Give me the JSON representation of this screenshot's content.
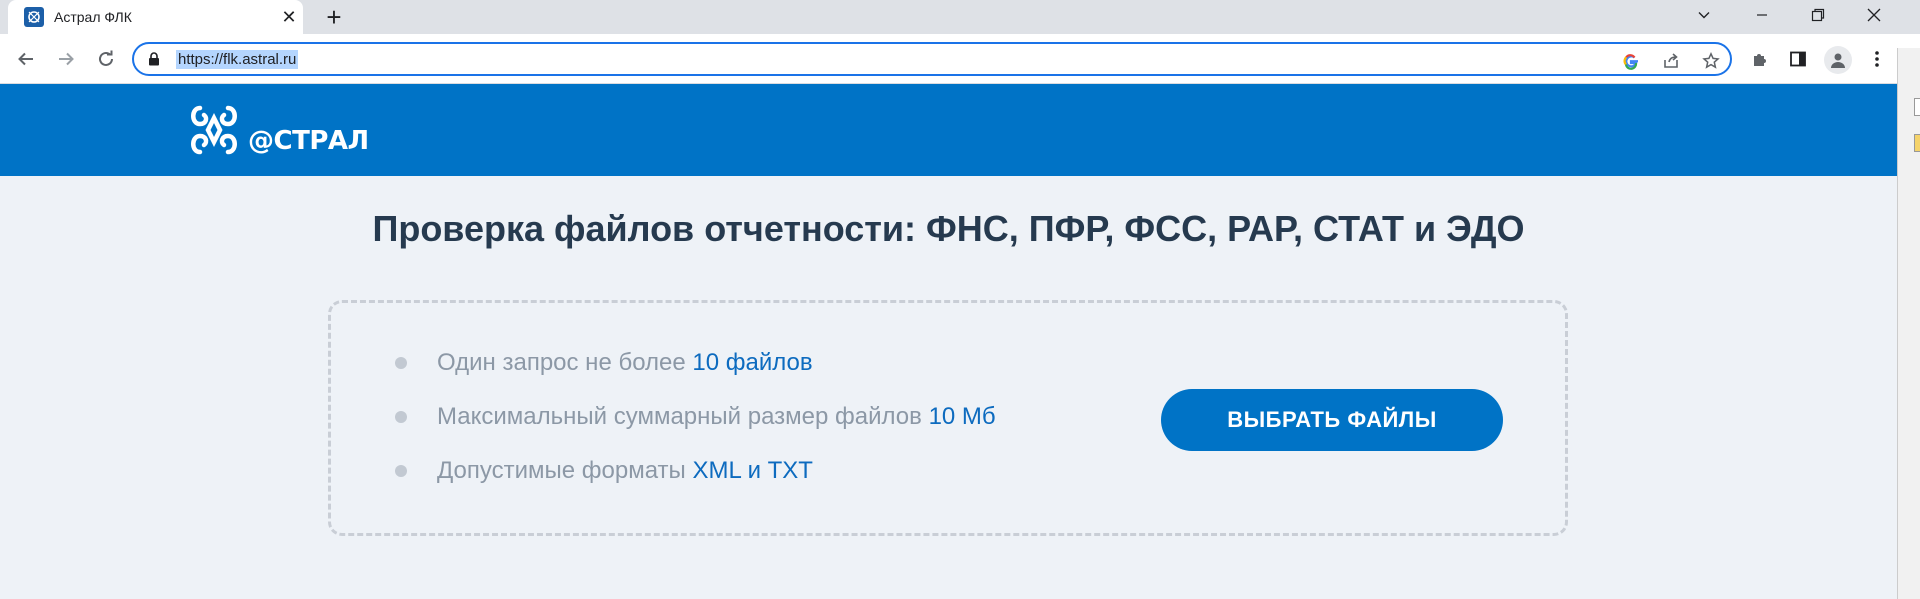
{
  "browser": {
    "tab_title": "Астрал ФЛК",
    "url": "https://flk.astral.ru",
    "new_tab_glyph": "+",
    "close_glyph": "✕"
  },
  "header": {
    "logo_text": "@СТРАЛ",
    "background": "#0073c6"
  },
  "main": {
    "title": "Проверка файлов отчетности: ФНС, ПФР, ФСС, РАР, СТАТ и ЭДО",
    "rules": [
      {
        "text": "Один запрос не более ",
        "highlight": "10 файлов"
      },
      {
        "text": "Максимальный суммарный размер файлов ",
        "highlight": "10 Мб"
      },
      {
        "text": "Допустимые форматы ",
        "highlight": "XML и TXT"
      }
    ],
    "select_button_label": "ВЫБРАТЬ ФАЙЛЫ",
    "accent": "#0d6bbf",
    "title_color": "#263a4f"
  }
}
